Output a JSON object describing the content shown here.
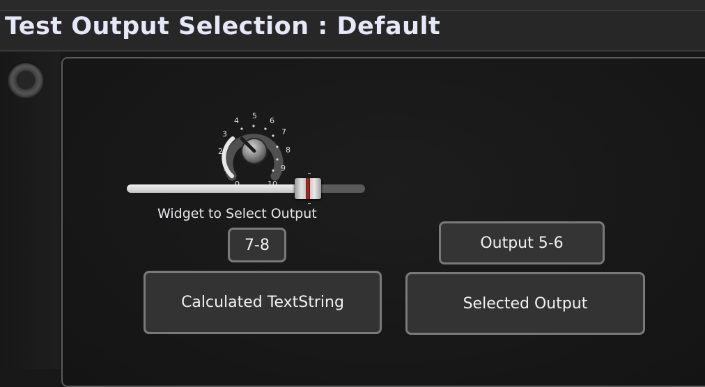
{
  "window": {
    "title": "Test Output Selection : Default"
  },
  "knob": {
    "dial_numbers": [
      "1",
      "2",
      "3",
      "4",
      "5",
      "6",
      "7",
      "8",
      "9"
    ],
    "clipped_numbers": [
      "0",
      "10"
    ],
    "value": 2.5
  },
  "slider": {
    "label": "Widget to Select Output",
    "value_fraction": 0.75
  },
  "readouts": {
    "selected_value": "7-8",
    "output_label": "Output 5-6"
  },
  "buttons": {
    "calculated": "Calculated TextString",
    "selected": "Selected Output"
  },
  "colors": {
    "background": "#181818",
    "title_text": "#e6e8f8",
    "box_border": "#7a7a7a",
    "thumb_mark": "#a5261e"
  }
}
